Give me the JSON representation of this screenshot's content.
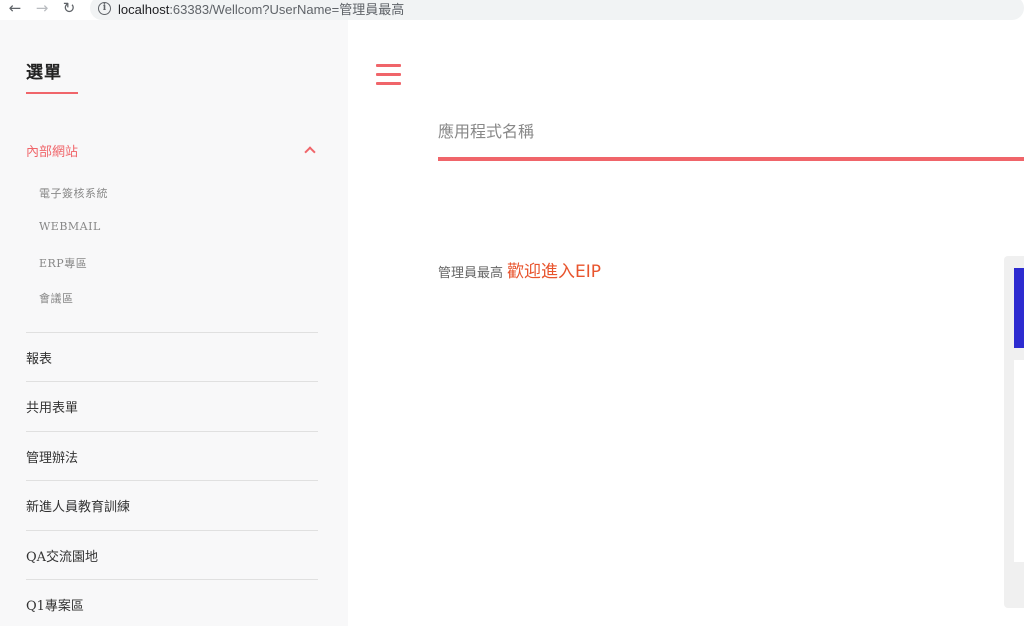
{
  "browser": {
    "back": "←",
    "forward": "→",
    "reload": "↻",
    "info": "i",
    "url_host": "localhost",
    "url_rest": ":63383/Wellcom?UserName=管理員最高"
  },
  "sidebar": {
    "title": "選單",
    "group": {
      "label": "內部網站",
      "items": [
        "電子簽核系統",
        "WEBMAIL",
        "ERP專區",
        "會議區"
      ]
    },
    "items": [
      "報表",
      "共用表單",
      "管理辦法",
      "新進人員教育訓練",
      "QA交流園地",
      "Q1專案區"
    ]
  },
  "main": {
    "app_name": "應用程式名稱",
    "user_name": "管理員最高",
    "welcome": "歡迎進入EIP"
  },
  "colors": {
    "accent": "#f0656a",
    "welcome": "#e8542d",
    "sidebar_bg": "#f8f8f9",
    "edge_blue": "#2d2bd0"
  },
  "icons": {
    "menu": "hamburger-icon",
    "collapse": "chevron-up-icon"
  }
}
